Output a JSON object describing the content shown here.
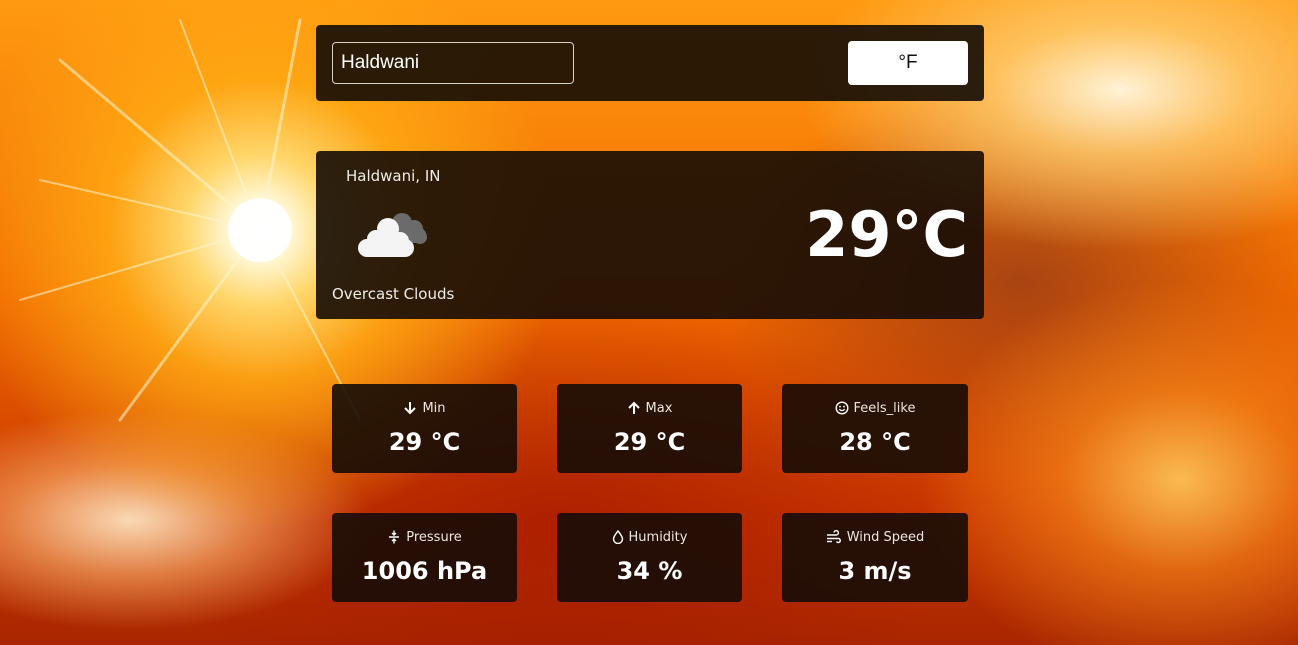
{
  "search": {
    "city_value": "Haldwani",
    "unit_button_label": "°F"
  },
  "current": {
    "location": "Haldwani, IN",
    "description": "Overcast Clouds",
    "temperature": "29°C",
    "icon": "overcast-clouds-icon"
  },
  "stats": {
    "min": {
      "label": "Min",
      "value": "29 °C",
      "icon": "arrow-down-icon"
    },
    "max": {
      "label": "Max",
      "value": "29 °C",
      "icon": "arrow-up-icon"
    },
    "feels_like": {
      "label": "Feels_like",
      "value": "28 °C",
      "icon": "smiley-icon"
    },
    "pressure": {
      "label": "Pressure",
      "value": "1006 hPa",
      "icon": "compress-icon"
    },
    "humidity": {
      "label": "Humidity",
      "value": "34 %",
      "icon": "droplet-icon"
    },
    "wind_speed": {
      "label": "Wind Speed",
      "value": "3 m/s",
      "icon": "wind-icon"
    }
  },
  "colors": {
    "panel_background": "#140c06",
    "text": "#ffffff",
    "button_background": "#ffffff",
    "button_text": "#111111"
  }
}
